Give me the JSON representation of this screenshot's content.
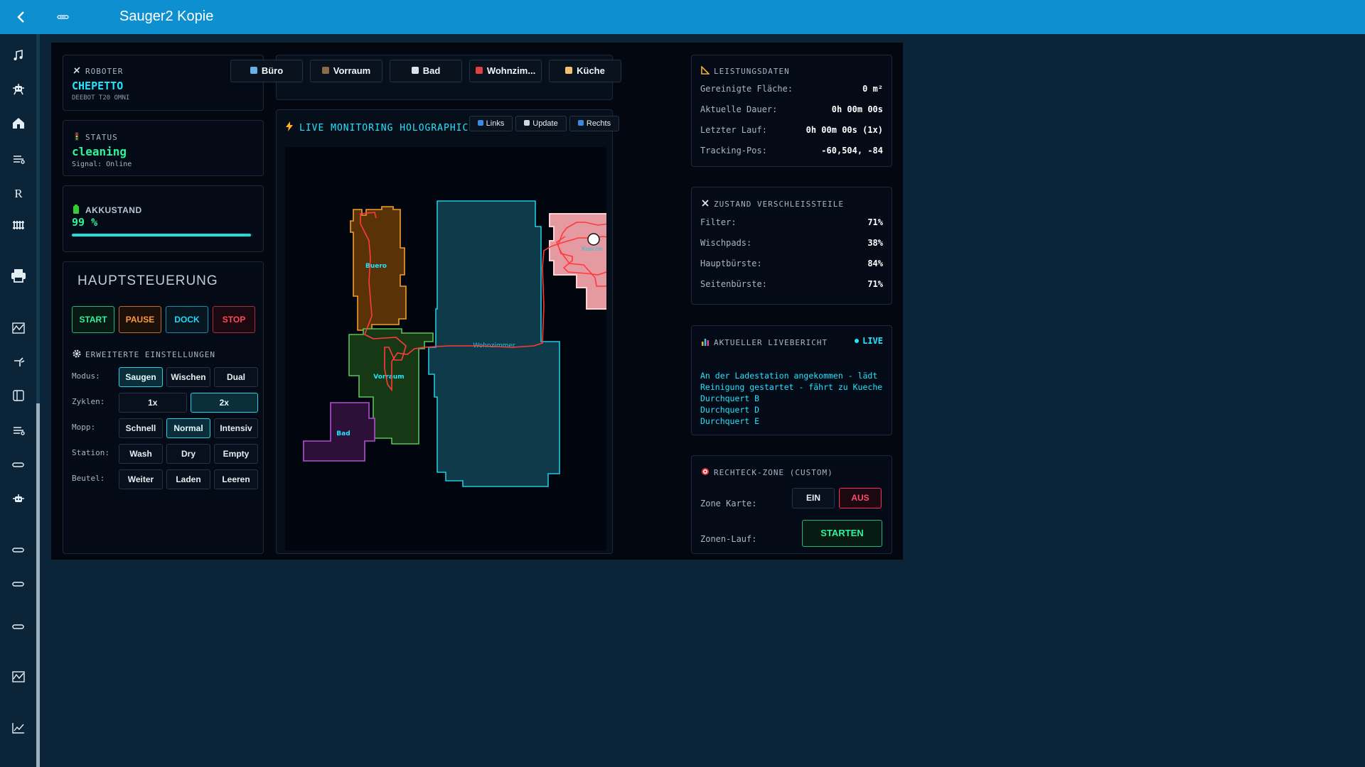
{
  "window": {
    "title": "Sauger2 Kopie"
  },
  "sidebar": {
    "icons": [
      "music-icon",
      "robot-icon",
      "home-icon",
      "vacuum-icon",
      "r-letter-icon",
      "radiator-icon",
      "printer-icon",
      "chart-icon",
      "sprinkler-icon",
      "panel-icon",
      "vacuum-icon",
      "robot-cleaner-icon",
      "robot-icon",
      "vacuum-icon",
      "vacuum-icon",
      "vacuum-icon",
      "chart-icon",
      "line-chart-icon"
    ],
    "r_letter": "R"
  },
  "robot": {
    "label": "ROBOTER",
    "name": "CHEPETTO",
    "model": "DEEBOT T20 OMNI"
  },
  "status": {
    "label": "STATUS",
    "value": "cleaning",
    "signal": "Signal: Online"
  },
  "battery": {
    "label": "AKKUSTAND",
    "value": "99 %",
    "percent": 99
  },
  "control": {
    "title": "HAUPTSTEUERUNG",
    "start": "START",
    "pause": "PAUSE",
    "dock": "DOCK",
    "stop": "STOP",
    "advanced_title": "ERWEITERTE EINSTELLUNGEN",
    "rows": [
      {
        "label": "Modus:",
        "options": [
          "Saugen",
          "Wischen",
          "Dual"
        ],
        "active": 0
      },
      {
        "label": "Zyklen:",
        "options": [
          "1x",
          "2x"
        ],
        "active": 1
      },
      {
        "label": "Mopp:",
        "options": [
          "Schnell",
          "Normal",
          "Intensiv"
        ],
        "active": 1
      },
      {
        "label": "Station:",
        "options": [
          "Wash",
          "Dry",
          "Empty"
        ],
        "active": -1
      },
      {
        "label": "Beutel:",
        "options": [
          "Weiter",
          "Laden",
          "Leeren"
        ],
        "active": -1
      }
    ]
  },
  "rooms": {
    "tabs": [
      {
        "label": "Büro",
        "icon": "office-icon"
      },
      {
        "label": "Vorraum",
        "icon": "door-icon"
      },
      {
        "label": "Bad",
        "icon": "bathtub-icon"
      },
      {
        "label": "Wohnzim...",
        "icon": "sofa-icon"
      },
      {
        "label": "Küche",
        "icon": "kitchen-icon"
      }
    ]
  },
  "map": {
    "title": "LIVE MONITORING HOLOGRAPHIC MAP",
    "btn_left": "Links",
    "btn_update": "Update",
    "btn_right": "Rechts",
    "room_labels": {
      "buero": "Buero",
      "vorraum": "Vorraum",
      "bad": "Bad",
      "wohnzimmer": "Wohnzimmer",
      "kueche": "Kueche"
    },
    "colors": {
      "buero": "#f0a030",
      "vorraum": "#5cc060",
      "bad": "#b050d0",
      "wohnzimmer": "#22c8e0",
      "kueche": "#f08a94",
      "path": "#ff3a3a"
    }
  },
  "performance": {
    "title": "LEISTUNGSDATEN",
    "rows": [
      {
        "k": "Gereinigte Fläche:",
        "v": "0 m²"
      },
      {
        "k": "Aktuelle Dauer:",
        "v": "0h 00m 00s"
      },
      {
        "k": "Letzter Lauf:",
        "v": "0h 00m 00s (1x)"
      },
      {
        "k": "Tracking-Pos:",
        "v": "-60,504, -84"
      }
    ]
  },
  "wear": {
    "title": "ZUSTAND VERSCHLEISSTEILE",
    "rows": [
      {
        "k": "Filter:",
        "v": "71%"
      },
      {
        "k": "Wischpads:",
        "v": "38%"
      },
      {
        "k": "Hauptbürste:",
        "v": "84%"
      },
      {
        "k": "Seitenbürste:",
        "v": "71%"
      }
    ]
  },
  "live_report": {
    "title": "AKTUELLER LIVEBERICHT",
    "badge": "LIVE",
    "lines": [
      "An der Ladestation angekommen - lädt",
      "Reinigung gestartet - fährt zu Kueche",
      "Durchquert B",
      "Durchquert D",
      "Durchquert E"
    ]
  },
  "zone": {
    "title": "RECHTECK-ZONE (CUSTOM)",
    "map_label": "Zone Karte:",
    "on": "EIN",
    "off": "AUS",
    "run_label": "Zonen-Lauf:",
    "start": "STARTEN"
  }
}
